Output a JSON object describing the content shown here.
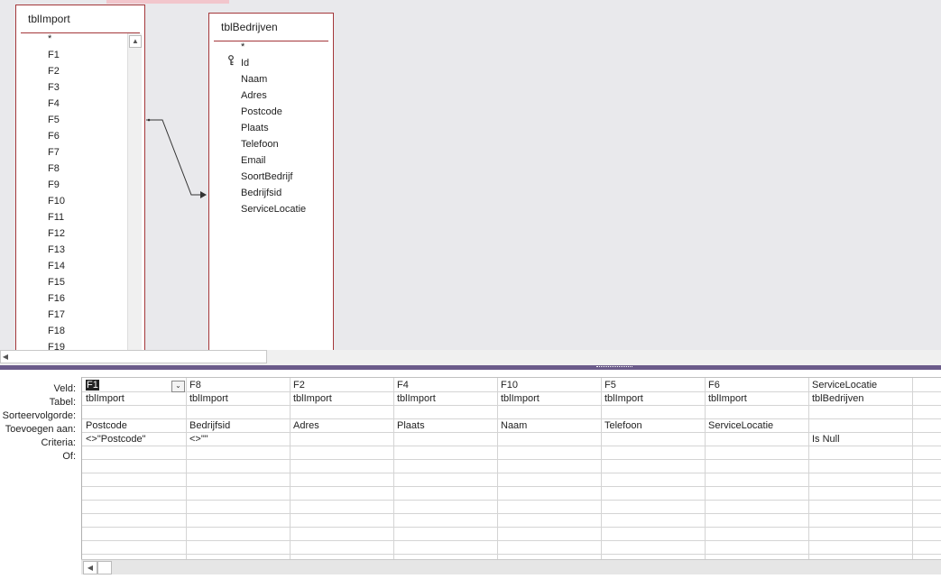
{
  "tables": [
    {
      "title": "tblImport",
      "fields": [
        "*",
        "F1",
        "F2",
        "F3",
        "F4",
        "F5",
        "F6",
        "F7",
        "F8",
        "F9",
        "F10",
        "F11",
        "F12",
        "F13",
        "F14",
        "F15",
        "F16",
        "F17",
        "F18",
        "F19"
      ]
    },
    {
      "title": "tblBedrijven",
      "fields": [
        "*",
        "Id",
        "Naam",
        "Adres",
        "Postcode",
        "Plaats",
        "Telefoon",
        "Email",
        "SoortBedrijf",
        "Bedrijfsid",
        "ServiceLocatie"
      ]
    }
  ],
  "row_labels": [
    "Veld:",
    "Tabel:",
    "Sorteervolgorde:",
    "Toevoegen aan:",
    "Criteria:",
    "Of:"
  ],
  "columns": [
    {
      "veld": "F1",
      "tabel": "tblImport",
      "sort": "",
      "toevoegen": "Postcode",
      "criteria": "<>\"Postcode\"",
      "of": ""
    },
    {
      "veld": "F8",
      "tabel": "tblImport",
      "sort": "",
      "toevoegen": "Bedrijfsid",
      "criteria": "<>\"\"",
      "of": ""
    },
    {
      "veld": "F2",
      "tabel": "tblImport",
      "sort": "",
      "toevoegen": "Adres",
      "criteria": "",
      "of": ""
    },
    {
      "veld": "F4",
      "tabel": "tblImport",
      "sort": "",
      "toevoegen": "Plaats",
      "criteria": "",
      "of": ""
    },
    {
      "veld": "F10",
      "tabel": "tblImport",
      "sort": "",
      "toevoegen": "Naam",
      "criteria": "",
      "of": ""
    },
    {
      "veld": "F5",
      "tabel": "tblImport",
      "sort": "",
      "toevoegen": "Telefoon",
      "criteria": "",
      "of": ""
    },
    {
      "veld": "F6",
      "tabel": "tblImport",
      "sort": "",
      "toevoegen": "ServiceLocatie",
      "criteria": "",
      "of": ""
    },
    {
      "veld": "ServiceLocatie",
      "tabel": "tblBedrijven",
      "sort": "",
      "toevoegen": "",
      "criteria": "Is Null",
      "of": ""
    }
  ],
  "icons": {
    "primary_key": "key-icon",
    "dropdown": "chevron-down-icon"
  },
  "colors": {
    "table_border": "#a4373a",
    "splitter": "#6b5b8a",
    "design_bg": "#e9e9ec"
  }
}
